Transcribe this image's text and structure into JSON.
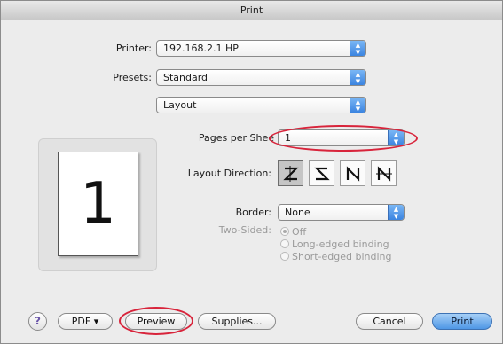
{
  "window": {
    "title": "Print"
  },
  "printer": {
    "label": "Printer:",
    "value": "192.168.2.1 HP"
  },
  "presets": {
    "label": "Presets:",
    "value": "Standard"
  },
  "panel": {
    "value": "Layout"
  },
  "preview": {
    "page_number": "1"
  },
  "pages_per_sheet": {
    "label": "Pages per Shee",
    "value": "1"
  },
  "layout_direction": {
    "label": "Layout Direction:",
    "options": [
      "z-order",
      "reverse-s-order",
      "reverse-n-order",
      "n-order"
    ]
  },
  "border": {
    "label": "Border:",
    "value": "None"
  },
  "two_sided": {
    "label": "Two-Sided:",
    "options": [
      "Off",
      "Long-edged binding",
      "Short-edged binding"
    ],
    "selected": "Off"
  },
  "buttons": {
    "help": "?",
    "pdf": "PDF ▾",
    "preview": "Preview",
    "supplies": "Supplies...",
    "cancel": "Cancel",
    "print": "Print"
  },
  "colors": {
    "accent": "#4f97e6",
    "highlight": "#d8243b"
  }
}
